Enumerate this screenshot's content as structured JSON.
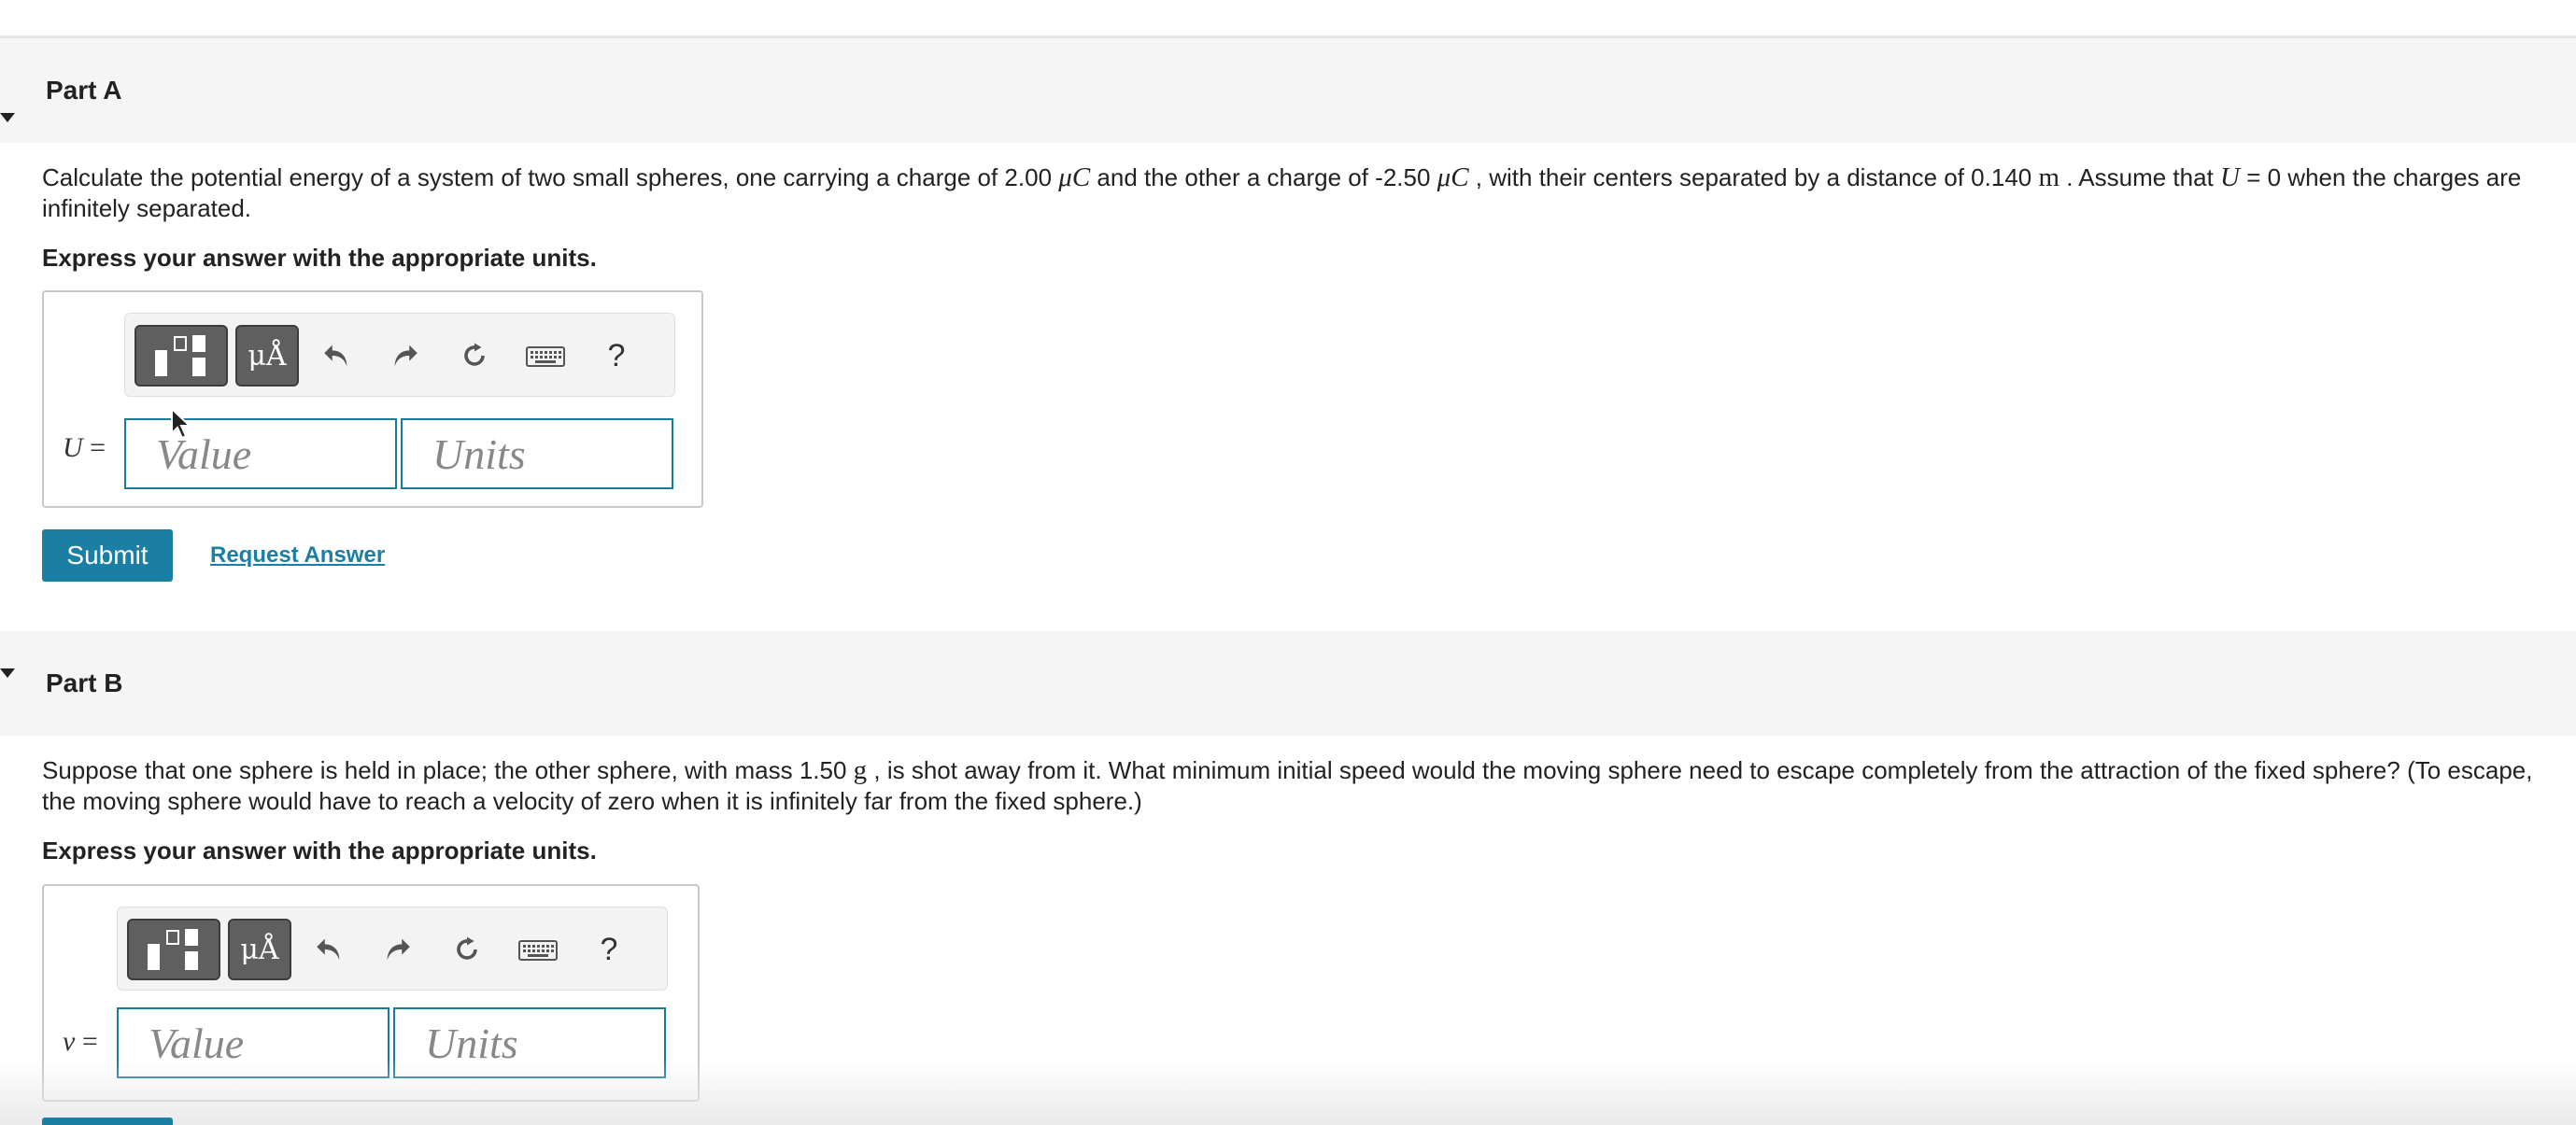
{
  "part_a": {
    "title": "Part A",
    "question": {
      "t1": "Calculate the potential energy of a system of two small spheres, one carrying a charge of 2.00 ",
      "u1": "μC",
      "t2": " and the other a charge of -2.50 ",
      "u2": "μC",
      "t3": " , with their centers separated by a distance of 0.140 ",
      "u3": "m",
      "t4": " . Assume that ",
      "var": "U",
      "t5": " = 0 when the charges are infinitely separated."
    },
    "instruction": "Express your answer with the appropriate units.",
    "answer": {
      "variable": "U",
      "equals": " =",
      "value_placeholder": "Value",
      "units_placeholder": "Units"
    },
    "submit_label": "Submit",
    "request_label": "Request Answer"
  },
  "part_b": {
    "title": "Part B",
    "question": {
      "t1": "Suppose that one sphere is held in place; the other sphere, with mass 1.50 ",
      "u1": "g",
      "t2": " , is shot away from it. What minimum initial speed would the moving sphere need to escape completely from the attraction of the fixed sphere? (To escape, the moving sphere would have to reach a velocity of zero when it is infinitely far from the fixed sphere.)"
    },
    "instruction": "Express your answer with the appropriate units.",
    "answer": {
      "variable": "v",
      "equals": " =",
      "value_placeholder": "Value",
      "units_placeholder": "Units"
    }
  },
  "toolbar": {
    "templates_icon": "templates-icon",
    "units_label": "μÅ",
    "undo_icon": "undo-icon",
    "redo_icon": "redo-icon",
    "reset_icon": "reset-icon",
    "keyboard_icon": "keyboard-icon",
    "help_label": "?"
  },
  "colors": {
    "accent": "#1b7fa3",
    "header_bg": "#f5f5f5",
    "toolbar_button": "#5f5f5f"
  }
}
